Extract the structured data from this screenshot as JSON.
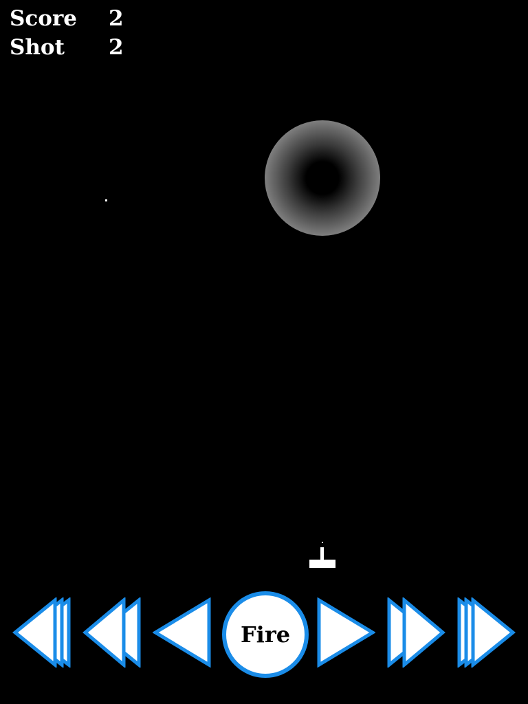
{
  "hud": {
    "score_label": "Score",
    "score_value": "2",
    "shot_label": "Shot",
    "shot_value": "2"
  },
  "controls": {
    "fire_label": "Fire",
    "buttons": [
      {
        "icon": "triple-left-arrow-icon"
      },
      {
        "icon": "double-left-arrow-icon"
      },
      {
        "icon": "left-arrow-icon"
      },
      {
        "icon": "fire-button"
      },
      {
        "icon": "right-arrow-icon"
      },
      {
        "icon": "double-right-arrow-icon"
      },
      {
        "icon": "triple-right-arrow-icon"
      }
    ]
  },
  "colors": {
    "background": "#000000",
    "control_outline": "#1a8ce8",
    "control_fill": "#ffffff",
    "hud_text": "#ffffff"
  }
}
